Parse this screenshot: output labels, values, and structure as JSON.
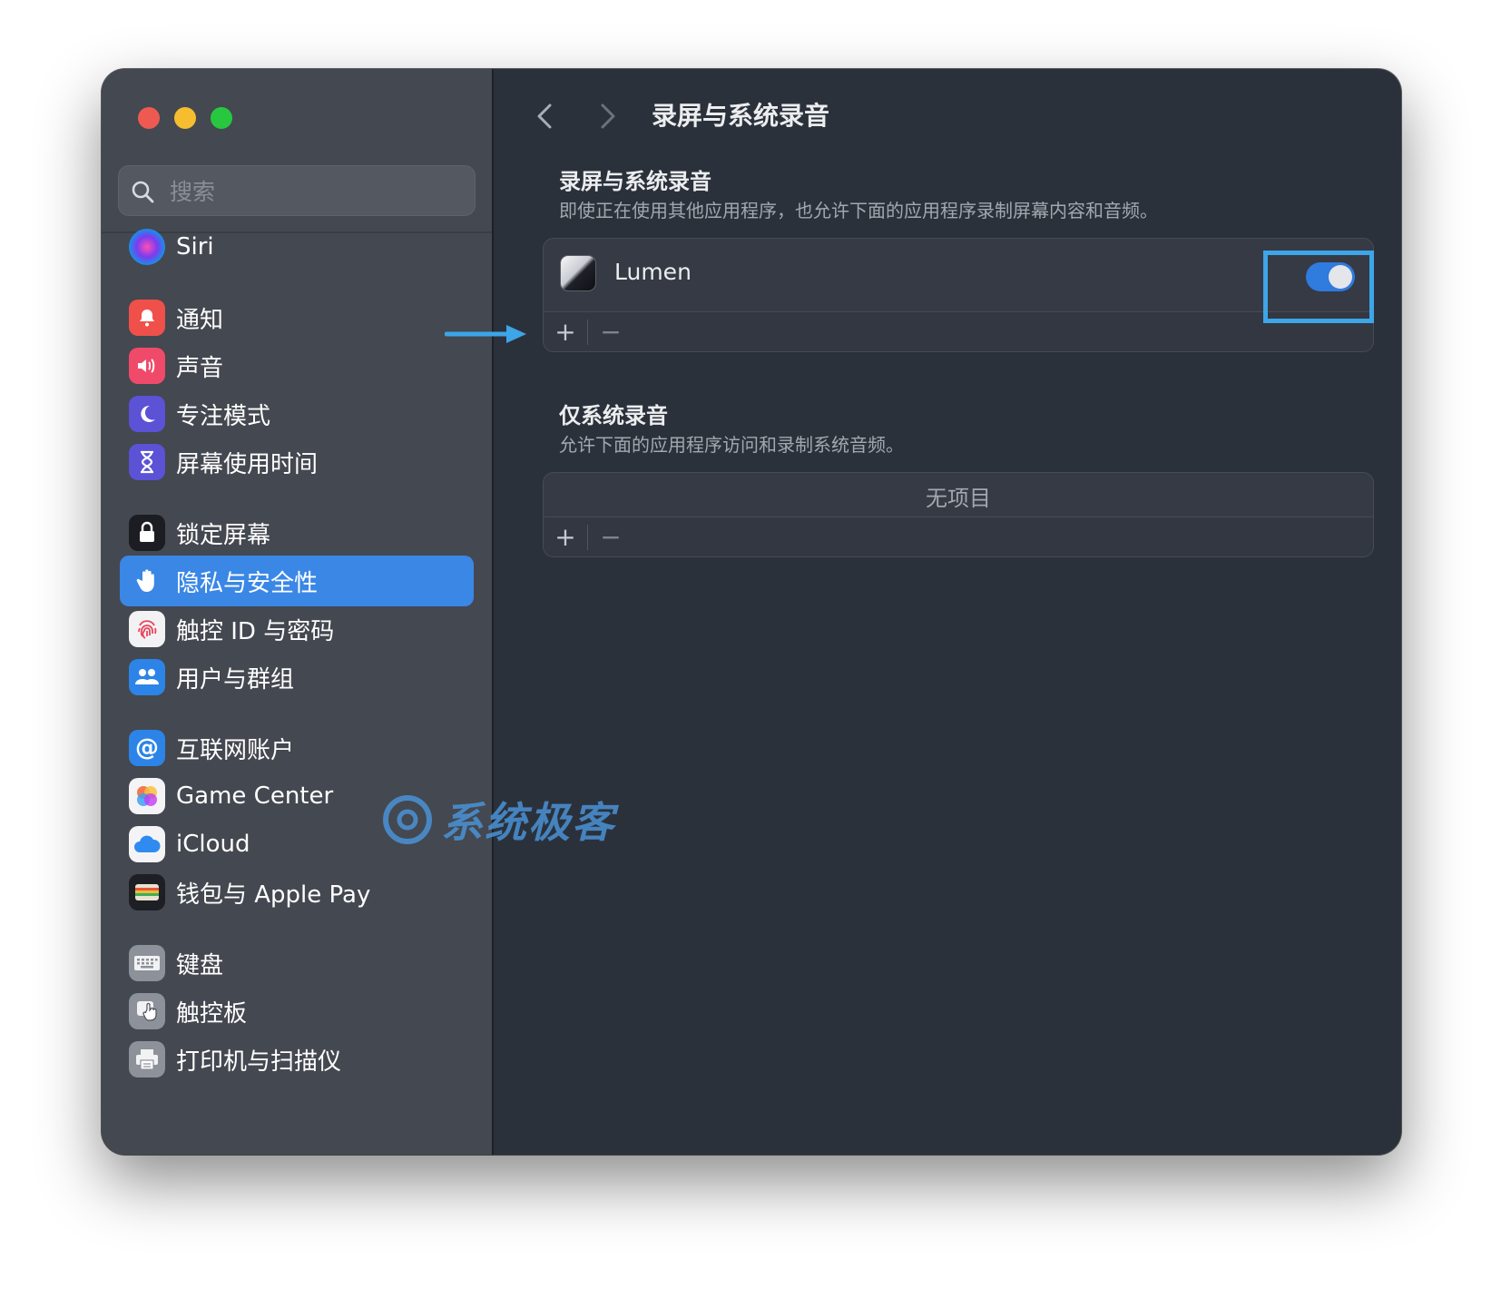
{
  "window": {
    "title": "录屏与系统录音"
  },
  "colors": {
    "accent": "#3a87e6",
    "toggle_on": "#2f7bde",
    "highlight_box": "#3da5e8"
  },
  "sidebar": {
    "search_placeholder": "搜索",
    "items": [
      {
        "label": "Siri",
        "icon": "siri-icon"
      },
      {
        "label": "通知",
        "icon": "bell-icon"
      },
      {
        "label": "声音",
        "icon": "speaker-icon"
      },
      {
        "label": "专注模式",
        "icon": "moon-icon"
      },
      {
        "label": "屏幕使用时间",
        "icon": "hourglass-icon"
      },
      {
        "label": "锁定屏幕",
        "icon": "lock-icon"
      },
      {
        "label": "隐私与安全性",
        "icon": "hand-icon",
        "selected": true
      },
      {
        "label": "触控 ID 与密码",
        "icon": "fingerprint-icon"
      },
      {
        "label": "用户与群组",
        "icon": "users-icon"
      },
      {
        "label": "互联网账户",
        "icon": "at-icon"
      },
      {
        "label": "Game Center",
        "icon": "game-center-icon"
      },
      {
        "label": "iCloud",
        "icon": "cloud-icon"
      },
      {
        "label": "钱包与 Apple Pay",
        "icon": "wallet-icon"
      },
      {
        "label": "键盘",
        "icon": "keyboard-icon"
      },
      {
        "label": "触控板",
        "icon": "trackpad-icon"
      },
      {
        "label": "打印机与扫描仪",
        "icon": "printer-icon"
      }
    ]
  },
  "content": {
    "page_title": "录屏与系统录音",
    "screen_section": {
      "title": "录屏与系统录音",
      "description": "即使正在使用其他应用程序，也允许下面的应用程序录制屏幕内容和音频。",
      "apps": [
        {
          "name": "Lumen",
          "enabled": true
        }
      ],
      "add_label": "+",
      "remove_label": "−"
    },
    "audio_section": {
      "title": "仅系统录音",
      "description": "允许下面的应用程序访问和录制系统音频。",
      "empty_label": "无项目",
      "add_label": "+",
      "remove_label": "−"
    }
  },
  "watermark": {
    "text": "系统极客"
  }
}
